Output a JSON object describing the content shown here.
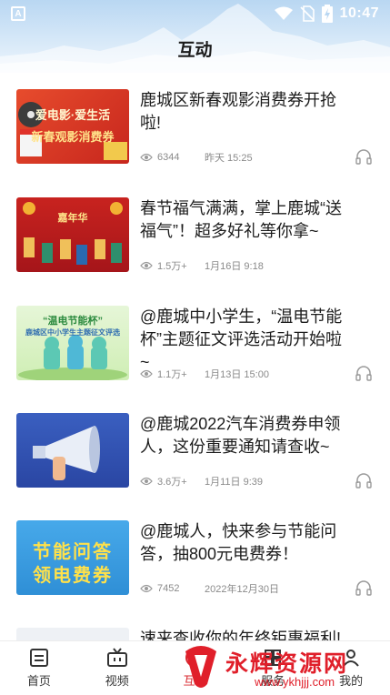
{
  "status_bar": {
    "time": "10:47",
    "app_badge": "A"
  },
  "header": {
    "title": "互动"
  },
  "news": [
    {
      "title": "鹿城区新春观影消费券开抢啦!",
      "views": "6344",
      "date": "昨天 15:25",
      "thumb": {
        "line1": "爱电影·爱生活",
        "line2": "新春观影消费券"
      }
    },
    {
      "title": "春节福气满满，掌上鹿城“送福气”！超多好礼等你拿~",
      "views": "1.5万+",
      "date": "1月16日 9:18",
      "thumb": {
        "line1": "嘉年华"
      }
    },
    {
      "title": "@鹿城中小学生，“温电节能杯”主题征文评选活动开始啦~",
      "views": "1.1万+",
      "date": "1月13日 15:00",
      "thumb": {
        "line1": "“温电节能杯”",
        "line2": "鹿城区中小学生主题征文评选"
      }
    },
    {
      "title": "@鹿城2022汽车消费券申领人，这份重要通知请查收~",
      "views": "3.6万+",
      "date": "1月11日 9:39",
      "thumb": {}
    },
    {
      "title": "@鹿城人，快来参与节能问答，抽800元电费券！",
      "views": "7452",
      "date": "2022年12月30日",
      "thumb": {
        "line1": "节能问答",
        "line2": "领电费券"
      }
    },
    {
      "title": "速来查收你的年终钜惠福利!"
    }
  ],
  "tabs": [
    {
      "label": "首页",
      "icon": "home-icon"
    },
    {
      "label": "视频",
      "icon": "tv-icon"
    },
    {
      "label": "互动",
      "icon": "interact-icon",
      "active": true
    },
    {
      "label": "服务",
      "icon": "service-icon"
    },
    {
      "label": "我的",
      "icon": "profile-icon"
    }
  ],
  "watermark": {
    "text": "永辉资源网",
    "url": "www.ykhjjj.com"
  },
  "colors": {
    "accent": "#d8252c",
    "meta_gray": "#8a8a8a"
  }
}
